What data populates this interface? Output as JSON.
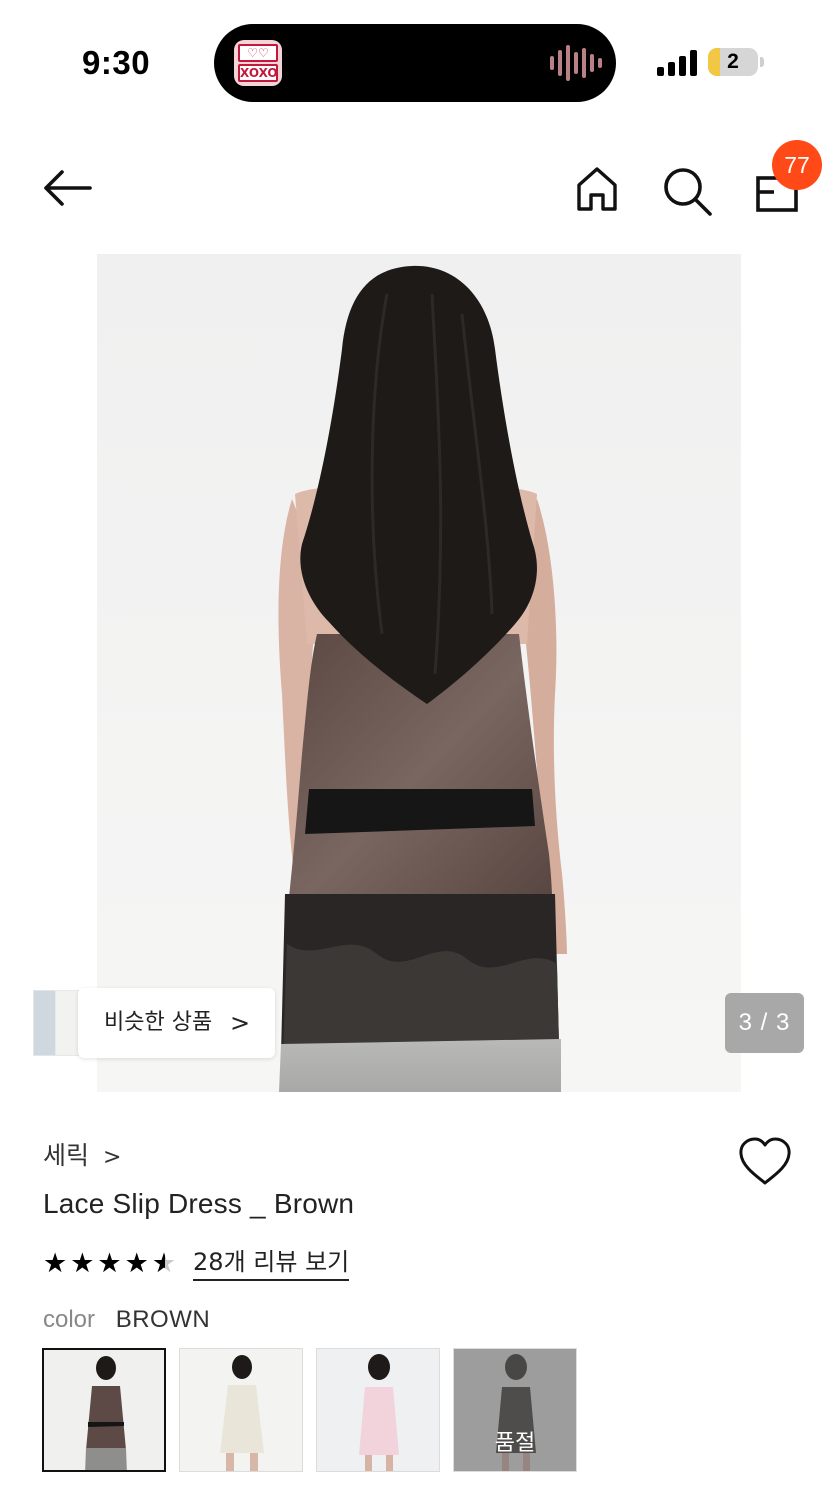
{
  "status_bar": {
    "time": "9:30",
    "battery_level": "2",
    "island_app_icon": "xoxo-app-icon",
    "island_top_text": "♡♡",
    "island_bottom_text": "XOXO"
  },
  "nav": {
    "cart_count": "77",
    "icons": [
      "back-arrow-icon",
      "home-icon",
      "search-icon",
      "shopping-bag-icon"
    ]
  },
  "gallery": {
    "page_counter": "3 / 3",
    "similar_button_label": "비슷한 상품",
    "similar_chevron": ">"
  },
  "product": {
    "brand": "세릭",
    "brand_chevron": ">",
    "name": "Lace Slip Dress _ Brown",
    "rating": 4.5,
    "rating_max": 5,
    "review_link": "28개 리뷰 보기",
    "color_label": "color",
    "color_value": "BROWN",
    "swatches": [
      {
        "color": "brown",
        "selected": true,
        "sold_out": false
      },
      {
        "color": "ivory",
        "selected": false,
        "sold_out": false
      },
      {
        "color": "pink",
        "selected": false,
        "sold_out": false
      },
      {
        "color": "black",
        "selected": false,
        "sold_out": true,
        "sold_out_label": "품절"
      }
    ]
  },
  "colors": {
    "badge": "#ff4a17",
    "counter_bg": "#a8a8a8",
    "dress_brown": "#6b5650",
    "hair": "#1e1a18"
  }
}
